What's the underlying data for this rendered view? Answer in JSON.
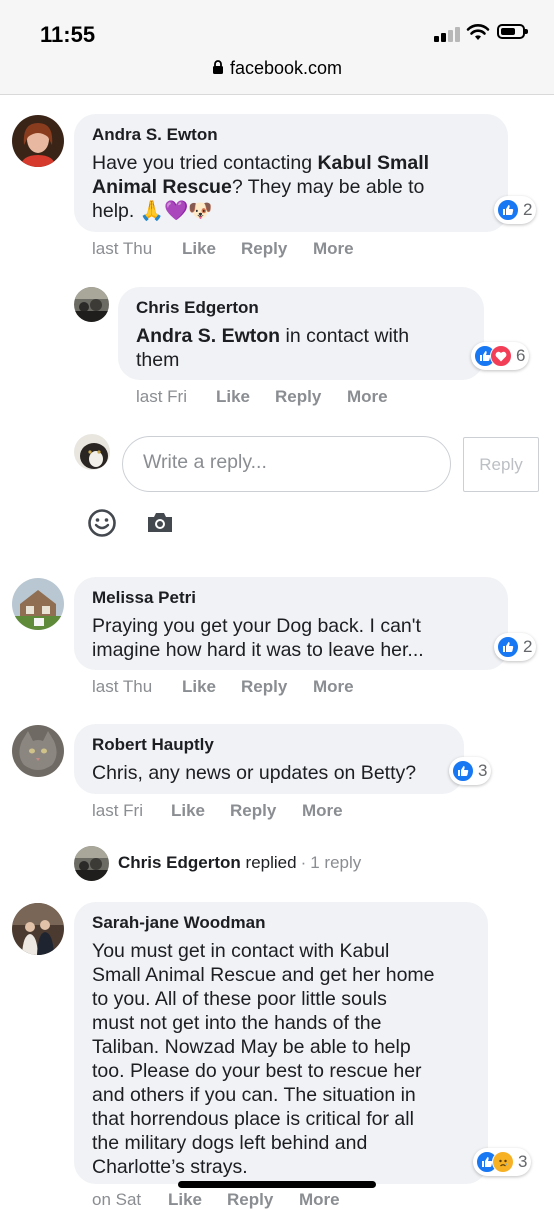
{
  "status_bar": {
    "time": "11:55",
    "url": "facebook.com"
  },
  "comments": [
    {
      "author": "Andra S. Ewton",
      "text_lines": [
        {
          "pre": "Have you tried contacting ",
          "bold": "Kabul Small"
        },
        {
          "bold": "Animal Rescue",
          "post": "? They may be able to"
        },
        {
          "pre": "help. 🙏💜🐶"
        }
      ],
      "time": "last Thu",
      "like": "Like",
      "reply": "Reply",
      "more": "More",
      "reaction_count": "2"
    },
    {
      "author": "Chris Edgerton",
      "text_lines": [
        {
          "bold": "Andra S. Ewton",
          "post": " in contact with"
        },
        {
          "pre": "them"
        }
      ],
      "time": "last Fri",
      "like": "Like",
      "reply": "Reply",
      "more": "More",
      "reaction_count": "6"
    },
    {
      "author": "Melissa Petri",
      "text_lines": [
        {
          "pre": "Praying you get your Dog back. I can't"
        },
        {
          "pre": "imagine how hard it was to leave her..."
        }
      ],
      "time": "last Thu",
      "like": "Like",
      "reply": "Reply",
      "more": "More",
      "reaction_count": "2"
    },
    {
      "author": "Robert Hauptly",
      "text_lines": [
        {
          "pre": "Chris, any news or updates on Betty?"
        }
      ],
      "time": "last Fri",
      "like": "Like",
      "reply": "Reply",
      "more": "More",
      "reaction_count": "3"
    },
    {
      "author": "Sarah-jane Woodman",
      "text_lines": [
        {
          "pre": "You must get in contact with Kabul"
        },
        {
          "pre": "Small Animal Rescue and get her home"
        },
        {
          "pre": "to you. All of these poor little souls"
        },
        {
          "pre": "must not get into the hands of the"
        },
        {
          "pre": "Taliban. Nowzad May be able to help"
        },
        {
          "pre": "too. Please do your best to rescue her"
        },
        {
          "pre": "and others if you can. The situation in"
        },
        {
          "pre": "that horrendous place is critical for all"
        },
        {
          "pre": "the military dogs left behind and"
        },
        {
          "pre": "Charlotte’s strays."
        }
      ],
      "time": "on Sat",
      "like": "Like",
      "reply": "Reply",
      "more": "More",
      "reaction_count": "3"
    }
  ],
  "reply_composer": {
    "placeholder": "Write a reply...",
    "button_label": "Reply"
  },
  "replied_summary": {
    "name": "Chris Edgerton",
    "word": "replied",
    "dot": "·",
    "count": "1 reply"
  },
  "icons": {
    "status": [
      "signal-icon",
      "wifi-icon",
      "battery-icon",
      "lock-icon"
    ],
    "composer": [
      "emoji-icon",
      "camera-icon"
    ],
    "reactions": [
      "like-reaction-icon",
      "love-reaction-icon",
      "sad-reaction-icon"
    ]
  },
  "colors": {
    "bubble": "#f0f2f5",
    "like_blue": "#1877f2",
    "love_red": "#f33e58",
    "meta_gray": "#8a8d91"
  }
}
